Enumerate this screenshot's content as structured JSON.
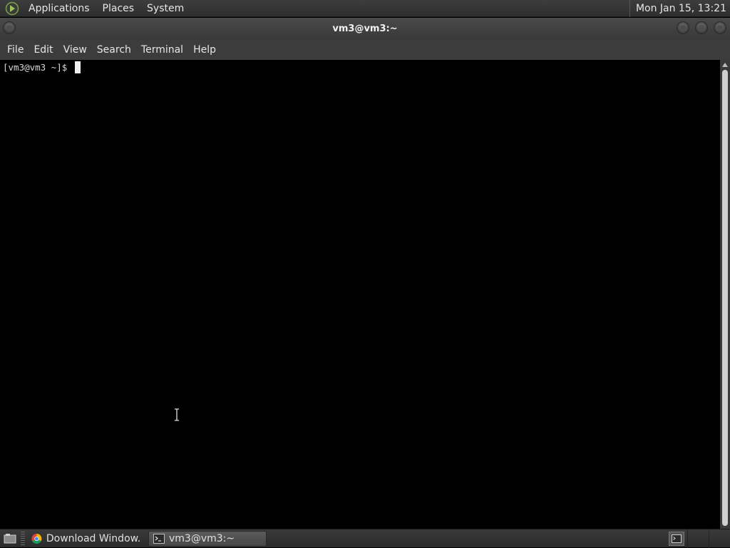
{
  "top_panel": {
    "menus": [
      "Applications",
      "Places",
      "System"
    ],
    "clock": "Mon Jan 15, 13:21"
  },
  "window": {
    "title": "vm3@vm3:~"
  },
  "menubar": {
    "items": [
      "File",
      "Edit",
      "View",
      "Search",
      "Terminal",
      "Help"
    ]
  },
  "terminal": {
    "prompt": "[vm3@vm3 ~]$ "
  },
  "taskbar": {
    "tasks": [
      {
        "label": "Download Window...",
        "icon": "chrome-icon",
        "active": false
      },
      {
        "label": "vm3@vm3:~",
        "icon": "terminal-icon",
        "active": true
      }
    ]
  },
  "colors": {
    "panel_bg": "#333333",
    "terminal_bg": "#000000",
    "terminal_fg": "#d8d8d8",
    "cursor": "#f0f0f0"
  }
}
